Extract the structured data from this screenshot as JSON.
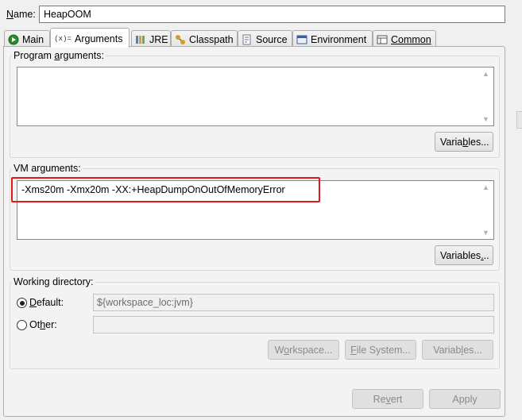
{
  "name": {
    "label_mnemonic": "N",
    "label_rest": "ame:",
    "value": "HeapOOM"
  },
  "tabs": [
    {
      "label": "Main",
      "icon": "main-run-icon",
      "active": false
    },
    {
      "label": "Arguments",
      "icon": "arguments-icon",
      "active": true
    },
    {
      "label": "JRE",
      "icon": "jre-library-icon",
      "active": false
    },
    {
      "label": "Classpath",
      "icon": "classpath-icon",
      "active": false
    },
    {
      "label": "Source",
      "icon": "source-icon",
      "active": false
    },
    {
      "label": "Environment",
      "icon": "environment-icon",
      "active": false
    },
    {
      "label": "Common",
      "icon": "common-icon",
      "active": false
    }
  ],
  "tab_icon_glyphs": {
    "arguments": "(x)="
  },
  "program_args": {
    "legend_pre": "Program ",
    "legend_mnemonic": "a",
    "legend_post": "rguments:",
    "value": "",
    "variables_pre": "Varia",
    "variables_mnemonic": "b",
    "variables_post": "les..."
  },
  "vm_args": {
    "legend": "VM arguments:",
    "value": "-Xms20m -Xmx20m -XX:+HeapDumpOnOutOfMemoryError",
    "variables_pre": "Variables",
    "variables_mnemonic": ".",
    "variables_post": "..",
    "highlight_color": "#e0191e"
  },
  "working_dir": {
    "legend": "Working directory:",
    "default_pre": "",
    "default_mnemonic": "D",
    "default_post": "efault:",
    "default_value": "${workspace_loc:jvm}",
    "other_pre": "Ot",
    "other_mnemonic": "h",
    "other_post": "er:",
    "other_value": "",
    "default_checked": true,
    "workspace_pre": "W",
    "workspace_mnemonic": "o",
    "workspace_post": "rkspace...",
    "filesystem_pre": "",
    "filesystem_mnemonic": "F",
    "filesystem_post": "ile System...",
    "variables_pre": "Variab",
    "variables_mnemonic": "l",
    "variables_post": "es..."
  },
  "footer": {
    "revert_pre": "Re",
    "revert_mnemonic": "v",
    "revert_post": "ert",
    "apply_label": "Apply"
  }
}
